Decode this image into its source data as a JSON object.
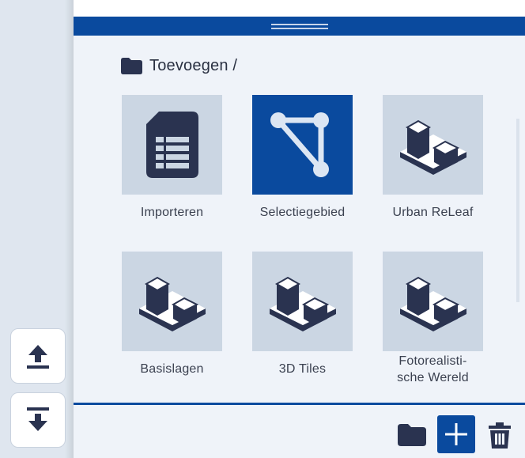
{
  "breadcrumb": {
    "label": "Toevoegen /"
  },
  "tiles": [
    {
      "label": "Importeren",
      "icon": "spreadsheet-icon"
    },
    {
      "label": "Selectiegebied",
      "icon": "polygon-select-icon",
      "selected": true
    },
    {
      "label": "Urban ReLeaf",
      "icon": "buildings-icon"
    },
    {
      "label": "Basislagen",
      "icon": "buildings-icon"
    },
    {
      "label": "3D Tiles",
      "icon": "buildings-icon"
    },
    {
      "label_line1": "Fotorealisti-",
      "label_line2": "sche Wereld",
      "icon": "buildings-icon"
    }
  ],
  "left_rail": {
    "buttons": [
      "upload-icon",
      "download-icon"
    ]
  },
  "bottom_toolbar": {
    "buttons": [
      "folder-icon",
      "add-icon",
      "trash-icon"
    ]
  },
  "colors": {
    "accent": "#0a4a9e",
    "tile_bg": "#cbd6e3",
    "panel_bg": "#eff3f9",
    "rail_bg": "#dfe6ef",
    "icon_dark": "#2a3350"
  }
}
